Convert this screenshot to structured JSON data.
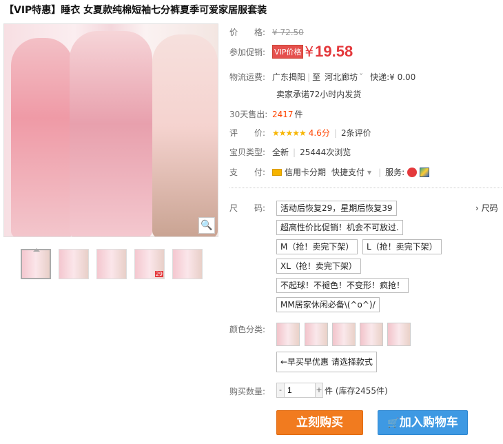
{
  "title": "【VIP特惠】睡衣 女夏款纯棉短袖七分裤夏季可爱家居服套装",
  "price": {
    "label": "价　　格:",
    "value": "¥ 72.50"
  },
  "promo": {
    "label": "参加促销:",
    "tag": "VIP价格",
    "yen": "¥",
    "value": "19.58"
  },
  "logistics": {
    "label": "物流运费:",
    "from": "广东揭阳",
    "sep": "|",
    "to": "至",
    "dest": "河北廊坊",
    "arrow": "ˇ",
    "express": "快递:",
    "fee": "¥ 0.00",
    "promise": "卖家承诺72小时内发货"
  },
  "sales": {
    "label": "30天售出:",
    "count": "2417",
    "unit": "件"
  },
  "rating": {
    "label": "评　　价:",
    "stars": "★★★★★",
    "score": "4.6分",
    "reviews": "2条评价"
  },
  "type": {
    "label": "宝贝类型:",
    "value": "全新",
    "views": "25444次浏览"
  },
  "payment": {
    "label": "支　　付:",
    "credit": "信用卡分期",
    "quick": "快捷支付",
    "arrow": "▾",
    "service": "服务:"
  },
  "size": {
    "label": "尺　　码:",
    "chart": "› 尺码",
    "options": [
      "活动后恢复29，星期后恢复39",
      "超高性价比促销！机会不可放过.",
      "M（抢！卖完下架）",
      "L（抢！卖完下架）",
      "XL（抢！卖完下架）",
      "不起球！不褪色！不变形！疯抢！",
      "MM居家休闲必备\\(^o^)/"
    ]
  },
  "color": {
    "label": "颜色分类:",
    "option": "←早买早优惠 请选择款式"
  },
  "quantity": {
    "label": "购买数量:",
    "minus": "-",
    "value": "1",
    "plus": "+",
    "stock": "件 (库存2455件)"
  },
  "buttons": {
    "buy": "立刻购买",
    "cart": "加入购物车",
    "cart_icon": "🛒"
  },
  "thumb_tag": "29",
  "zoom_icon": "🔍",
  "colors": {
    "accent": "#e4393c",
    "buy": "#f17b1f",
    "cart": "#3e99e3",
    "stars": "#f7b500"
  }
}
